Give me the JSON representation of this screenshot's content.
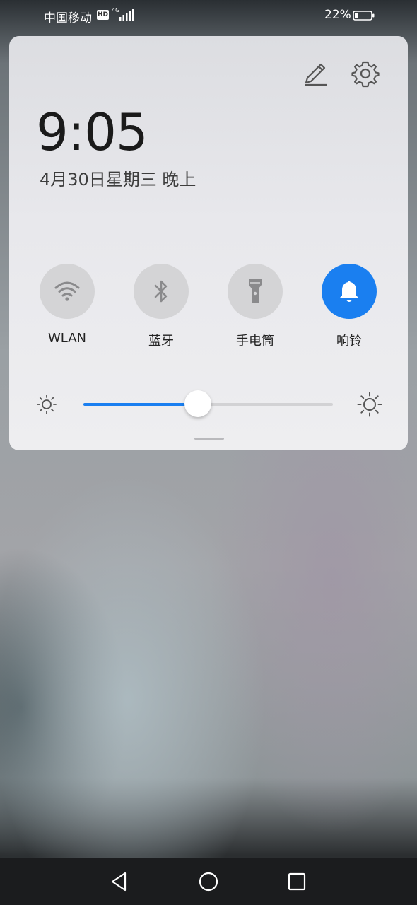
{
  "status_bar": {
    "carrier": "中国移动",
    "hd_badge": "HD",
    "network_type": "4G",
    "battery_percent": "22%",
    "battery_level": 0.22
  },
  "panel": {
    "edit_icon": "edit-pencil-icon",
    "settings_icon": "gear-icon",
    "time": "9:05",
    "date": "4月30日星期三 晚上"
  },
  "toggles": [
    {
      "label": "WLAN",
      "icon": "wifi-icon",
      "active": false
    },
    {
      "label": "蓝牙",
      "icon": "bluetooth-icon",
      "active": false
    },
    {
      "label": "手电筒",
      "icon": "flashlight-icon",
      "active": false
    },
    {
      "label": "响铃",
      "icon": "bell-icon",
      "active": true
    }
  ],
  "brightness": {
    "level": 0.46,
    "low_icon": "brightness-low-icon",
    "high_icon": "brightness-high-icon"
  },
  "colors": {
    "accent": "#1a7ff0",
    "toggle_inactive": "#d4d4d6"
  },
  "nav_bar": {
    "back_icon": "back-triangle-icon",
    "home_icon": "home-circle-icon",
    "recent_icon": "recent-square-icon"
  }
}
